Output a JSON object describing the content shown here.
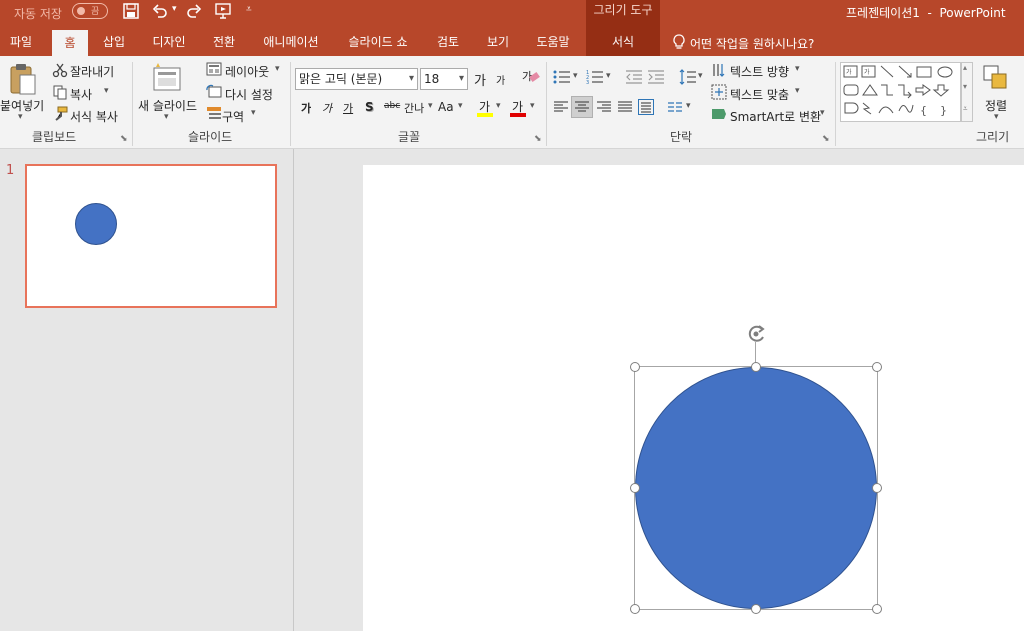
{
  "titlebar": {
    "autosave_label": "자동 저장",
    "autosave_state": "끔",
    "contextual_group": "그리기 도구",
    "document_title": "프레젠테이션1  -  PowerPoint"
  },
  "tabs": [
    {
      "label": "파일"
    },
    {
      "label": "홈"
    },
    {
      "label": "삽입"
    },
    {
      "label": "디자인"
    },
    {
      "label": "전환"
    },
    {
      "label": "애니메이션"
    },
    {
      "label": "슬라이드 쇼"
    },
    {
      "label": "검토"
    },
    {
      "label": "보기"
    },
    {
      "label": "도움말"
    },
    {
      "label": "서식"
    }
  ],
  "tell_me": "어떤 작업을 원하시나요?",
  "ribbon": {
    "clipboard": {
      "paste": "붙여넣기",
      "cut": "잘라내기",
      "copy": "복사",
      "format_painter": "서식 복사",
      "label": "클립보드"
    },
    "slides": {
      "new_slide": "새 슬라이드",
      "layout": "레이아웃",
      "reset": "다시 설정",
      "section": "구역",
      "label": "슬라이드"
    },
    "font": {
      "font_name": "맑은 고딕 (본문)",
      "font_size": "18",
      "grow": "가",
      "shrink": "가",
      "clear": "가",
      "bold": "가",
      "italic": "가",
      "underline": "가",
      "shadow": "S",
      "strike": "abc",
      "spacing": "간나",
      "case": "Aa",
      "highlight": "가",
      "font_color": "가",
      "label": "글꼴"
    },
    "paragraph": {
      "text_direction": "텍스트 방향",
      "align_text": "텍스트 맞춤",
      "smartart": "SmartArt로 변환",
      "label": "단락"
    },
    "drawing": {
      "arrange": "정렬",
      "label": "그리기"
    }
  },
  "slides_panel": {
    "slide_number": "1"
  },
  "colors": {
    "accent": "#b7472a",
    "shape_fill": "#4472c4",
    "shape_outline": "#2f528f"
  }
}
